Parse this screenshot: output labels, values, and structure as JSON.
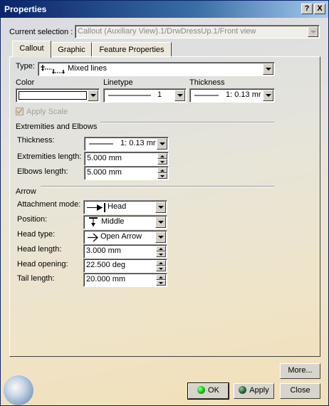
{
  "window": {
    "title": "Properties",
    "help_label": "?",
    "close_label": "X"
  },
  "selection": {
    "label": "Current selection :",
    "value": "Callout (Auxiliary View).1/DrwDressUp.1/Front view"
  },
  "tabs": [
    {
      "label": "Callout",
      "active": true
    },
    {
      "label": "Graphic",
      "active": false
    },
    {
      "label": "Feature Properties",
      "active": false
    }
  ],
  "callout": {
    "type_label": "Type:",
    "type_value": "Mixed lines",
    "color_label": "Color",
    "linetype_label": "Linetype",
    "linetype_value": "1",
    "thickness_label": "Thickness",
    "thickness_value": "1: 0.13 mr",
    "apply_scale_label": "Apply Scale"
  },
  "extremities": {
    "group_label": "Extremities and Elbows",
    "thickness_label": "Thickness:",
    "thickness_value": "1: 0.13 mr",
    "extremities_length_label": "Extremities length:",
    "extremities_length_value": "5.000 mm",
    "elbows_length_label": "Elbows length:",
    "elbows_length_value": "5.000 mm"
  },
  "arrow": {
    "group_label": "Arrow",
    "attachment_mode_label": "Attachment mode:",
    "attachment_mode_value": "Head",
    "position_label": "Position:",
    "position_value": "Middle",
    "head_type_label": "Head type:",
    "head_type_value": "Open Arrow",
    "head_length_label": "Head length:",
    "head_length_value": "3.000 mm",
    "head_opening_label": "Head opening:",
    "head_opening_value": "22.500 deg",
    "tail_length_label": "Tail length:",
    "tail_length_value": "20.000 mm"
  },
  "buttons": {
    "more_label": "More...",
    "ok_label": "OK",
    "apply_label": "Apply",
    "close_label": "Close"
  }
}
